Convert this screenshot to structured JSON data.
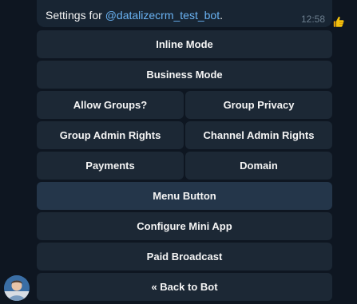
{
  "message": {
    "prefix": "Settings for ",
    "mention": "@datalizecrm_test_bot",
    "suffix": ".",
    "time": "12:58"
  },
  "reaction": {
    "icon": "thumbs-up-icon"
  },
  "keyboard": {
    "inline_mode": "Inline Mode",
    "business_mode": "Business Mode",
    "allow_groups": "Allow Groups?",
    "group_privacy": "Group Privacy",
    "group_admin_rights": "Group Admin Rights",
    "channel_admin_rights": "Channel Admin Rights",
    "payments": "Payments",
    "domain": "Domain",
    "menu_button": "Menu Button",
    "configure_mini_app": "Configure Mini App",
    "paid_broadcast": "Paid Broadcast",
    "back_to_bot": "« Back to Bot"
  },
  "colors": {
    "background": "#0e1621",
    "bubble": "#182533",
    "button": "#1c2835",
    "button_highlight": "#24364a",
    "mention": "#6ab3f3"
  }
}
